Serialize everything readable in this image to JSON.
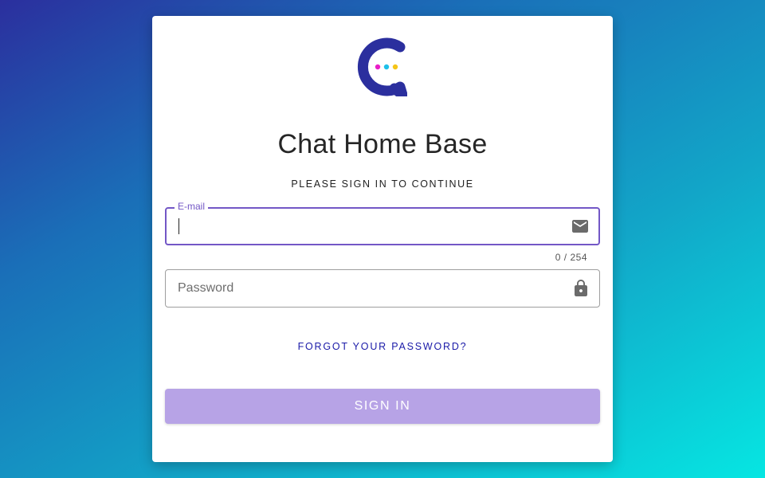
{
  "app": {
    "title": "Chat Home Base",
    "subtitle": "PLEASE SIGN IN TO CONTINUE",
    "logo_icon": "chat-logo-icon",
    "colors": {
      "accent": "#7357c6",
      "button_bg": "#b7a3e6",
      "link": "#1a1aa8",
      "logo_primary": "#2b2f9e",
      "logo_dots": [
        "#e91ec8",
        "#1ec0e9",
        "#f5c518"
      ]
    }
  },
  "form": {
    "email": {
      "label": "E-mail",
      "value": "",
      "counter": "0 / 254",
      "icon": "mail-icon"
    },
    "password": {
      "placeholder": "Password",
      "value": "",
      "icon": "lock-icon"
    },
    "forgot_label": "FORGOT YOUR PASSWORD?",
    "submit_label": "SIGN IN"
  }
}
